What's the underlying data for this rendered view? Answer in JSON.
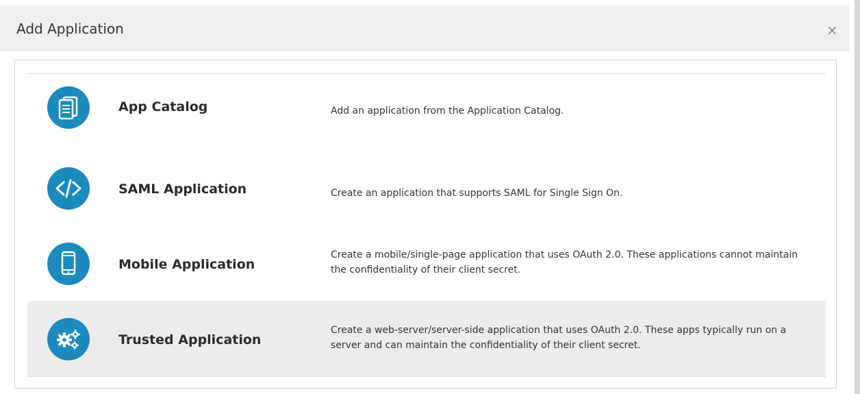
{
  "dialog": {
    "title": "Add Application",
    "close_label": "×"
  },
  "options": [
    {
      "title": "App Catalog",
      "description": "Add an application from the Application Catalog.",
      "icon": "catalog-icon"
    },
    {
      "title": "SAML Application",
      "description": "Create an application that supports SAML for Single Sign On.",
      "icon": "code-icon"
    },
    {
      "title": "Mobile Application",
      "description": "Create a mobile/single-page application that uses OAuth 2.0. These applications cannot maintain the confidentiality of their client secret.",
      "icon": "mobile-phone-icon"
    },
    {
      "title": "Trusted Application",
      "description": "Create a web-server/server-side application that uses OAuth 2.0. These apps typically run on a server and can maintain the confidentiality of their client secret.",
      "icon": "gears-icon"
    }
  ],
  "colors": {
    "accent": "#1b8abd",
    "highlight_row": "#ececec",
    "header_bg": "#f0f0f0"
  }
}
